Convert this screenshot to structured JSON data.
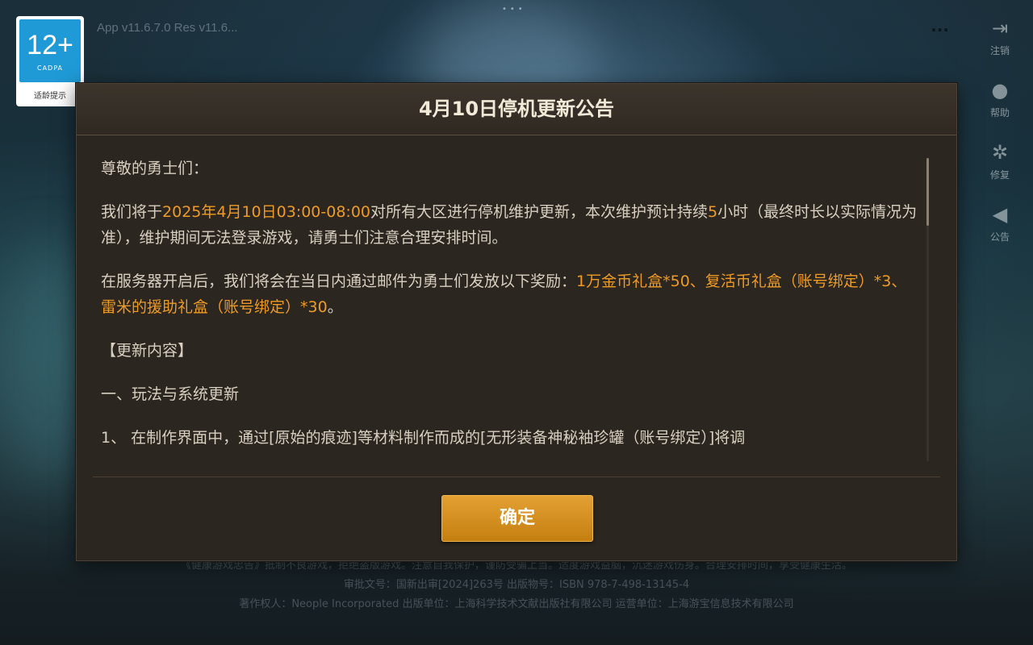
{
  "background": {
    "age_badge": {
      "rating": "12+",
      "org": "CADPA",
      "caption": "适龄提示"
    },
    "version_text": "App v11.6.7.0 Res v11.6...",
    "top_right_text": "...",
    "side_menu": [
      {
        "icon": "logout-icon",
        "label": "注销"
      },
      {
        "icon": "help-icon",
        "label": "帮助"
      },
      {
        "icon": "repair-icon",
        "label": "修复"
      },
      {
        "icon": "announcement-icon",
        "label": "公告"
      }
    ],
    "footer": {
      "line1": "《健康游戏忠告》抵制不良游戏，拒绝盗版游戏。注意自我保护，谨防受骗上当。适度游戏益脑，沉迷游戏伤身。合理安排时间，享受健康生活。",
      "line2": "审批文号：国新出审[2024]263号  出版物号：ISBN 978-7-498-13145-4",
      "line3": "著作权人：Neople Incorporated  出版单位：上海科学技术文献出版社有限公司  运营单位：上海游宝信息技术有限公司"
    }
  },
  "dialog": {
    "title": "4月10日停机更新公告",
    "greeting": "尊敬的勇士们：",
    "p1": {
      "a": "我们将于",
      "b": "2025年4月10日03:00-08:00",
      "c": "对所有大区进行停机维护更新，本次维护预计持续",
      "d": "5",
      "e": "小时（最终时长以实际情况为准），维护期间无法登录游戏，请勇士们注意合理安排时间。"
    },
    "p2": {
      "a": "在服务器开启后，我们将会在当日内通过邮件为勇士们发放以下奖励：",
      "b": "1万金币礼盒*50、复活币礼盒（账号绑定）*3、雷米的援助礼盒（账号绑定）*30",
      "c": "。"
    },
    "section_heading": "【更新内容】",
    "subsection_heading": "一、玩法与系统更新",
    "item1": "1、 在制作界面中，通过[原始的痕迹]等材料制作而成的[无形装备神秘袖珍罐（账号绑定）]将调",
    "ok_label": "确定",
    "highlight_color": "#ee9b25"
  }
}
